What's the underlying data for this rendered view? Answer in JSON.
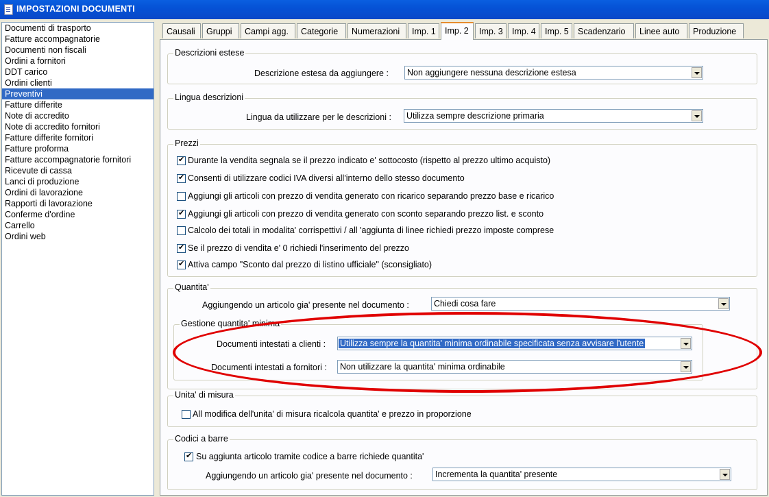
{
  "window": {
    "title": "IMPOSTAZIONI DOCUMENTI"
  },
  "doc_types": [
    "Documenti di trasporto",
    "Fatture accompagnatorie",
    "Documenti non fiscali",
    "Ordini a fornitori",
    "DDT carico",
    "Ordini clienti",
    "Preventivi",
    "Fatture differite",
    "Note di accredito",
    "Note di accredito fornitori",
    "Fatture differite fornitori",
    "Fatture proforma",
    "Fatture accompagnatorie fornitori",
    "Ricevute di cassa",
    "Lanci di produzione",
    "Ordini di lavorazione",
    "Rapporti di lavorazione",
    "Conferme d'ordine",
    "Carrello",
    "Ordini web"
  ],
  "selected_doc_type": "Preventivi",
  "tabs": [
    "Causali",
    "Gruppi",
    "Campi agg.",
    "Categorie",
    "Numerazioni",
    "Imp. 1",
    "Imp. 2",
    "Imp. 3",
    "Imp. 4",
    "Imp. 5",
    "Scadenzario",
    "Linee auto",
    "Produzione"
  ],
  "active_tab": "Imp. 2",
  "descrizioni": {
    "title": "Descrizioni estese",
    "label": "Descrizione estesa da aggiungere :",
    "value": "Non aggiungere nessuna descrizione estesa"
  },
  "lingua": {
    "title": "Lingua descrizioni",
    "label": "Lingua da utilizzare per le descrizioni :",
    "value": "Utilizza sempre descrizione primaria"
  },
  "prezzi": {
    "title": "Prezzi",
    "options": [
      {
        "label": "Durante la vendita segnala se il prezzo indicato e' sottocosto (rispetto al prezzo ultimo acquisto)",
        "checked": true
      },
      {
        "label": "Consenti di utilizzare codici IVA diversi all'interno dello stesso documento",
        "checked": true
      },
      {
        "label": "Aggiungi gli articoli con prezzo di vendita generato con ricarico separando prezzo base e ricarico",
        "checked": false
      },
      {
        "label": "Aggiungi gli articoli con prezzo di vendita generato con sconto separando prezzo list. e sconto",
        "checked": true
      },
      {
        "label": "Calcolo dei totali in modalita' corrispettivi / all 'aggiunta di linee richiedi prezzo imposte comprese",
        "checked": false
      },
      {
        "label": "Se il prezzo di vendita e' 0 richiedi l'inserimento del prezzo",
        "checked": true
      },
      {
        "label": "Attiva campo \"Sconto dal prezzo di listino ufficiale\" (sconsigliato)",
        "checked": true
      }
    ]
  },
  "quantita": {
    "title": "Quantita'",
    "label": "Aggiungendo un articolo gia' presente nel documento :",
    "value": "Chiedi cosa fare",
    "minima": {
      "title": "Gestione quantita' minima",
      "clienti_label": "Documenti intestati a clienti :",
      "clienti_value": "Utilizza sempre la quantita' minima ordinabile specificata senza avvisare l'utente",
      "fornitori_label": "Documenti intestati a fornitori :",
      "fornitori_value": "Non utilizzare la quantita' minima ordinabile"
    }
  },
  "unita": {
    "title": "Unita' di misura",
    "option": {
      "label": "All modifica dell'unita' di misura ricalcola quantita' e prezzo in proporzione",
      "checked": false
    }
  },
  "barre": {
    "title": "Codici a barre",
    "option": {
      "label": "Su aggiunta articolo tramite codice a barre richiede quantita'",
      "checked": true
    },
    "label": "Aggiungendo un articolo gia' presente nel documento :",
    "value": "Incrementa la quantita' presente"
  },
  "colors": {
    "title_bar": "#0552d6",
    "selection": "#316ac5",
    "annotation_ring": "#e00000",
    "active_tab_accent": "#e68b2c"
  }
}
